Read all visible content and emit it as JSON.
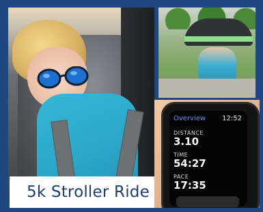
{
  "caption": {
    "text": "5k Stroller Ride"
  },
  "watch": {
    "title": "Overview",
    "clock": "12:52",
    "metrics": [
      {
        "label": "DISTANCE",
        "value": "3.10"
      },
      {
        "label": "TIME",
        "value": "54:27"
      },
      {
        "label": "PACE",
        "value": "17:35"
      }
    ]
  },
  "colors": {
    "frame": "#1f4780",
    "caption_text": "#1f3e6e",
    "watch_title": "#6e8cff"
  }
}
